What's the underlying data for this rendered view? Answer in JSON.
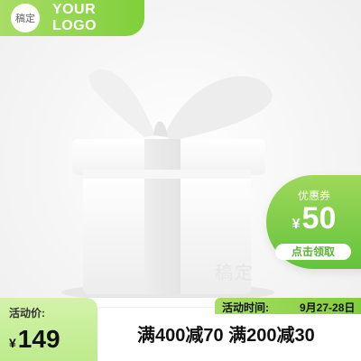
{
  "branding": {
    "badge_text": "稿定",
    "logo_text": "YOUR LOGO",
    "brand_color": "#7fcf3a"
  },
  "illustration": {
    "icon": "gift-box-icon",
    "watermark_text": "稿定"
  },
  "coupon": {
    "title": "优惠券",
    "currency": "¥",
    "value": "50",
    "cta": "点击领取"
  },
  "pricing": {
    "label": "活动价:",
    "currency": "¥",
    "value": "149"
  },
  "activity_time": {
    "label": "活动时间:",
    "value": "9月27-28日"
  },
  "promotions": {
    "text": "满400减70 满200减30"
  }
}
